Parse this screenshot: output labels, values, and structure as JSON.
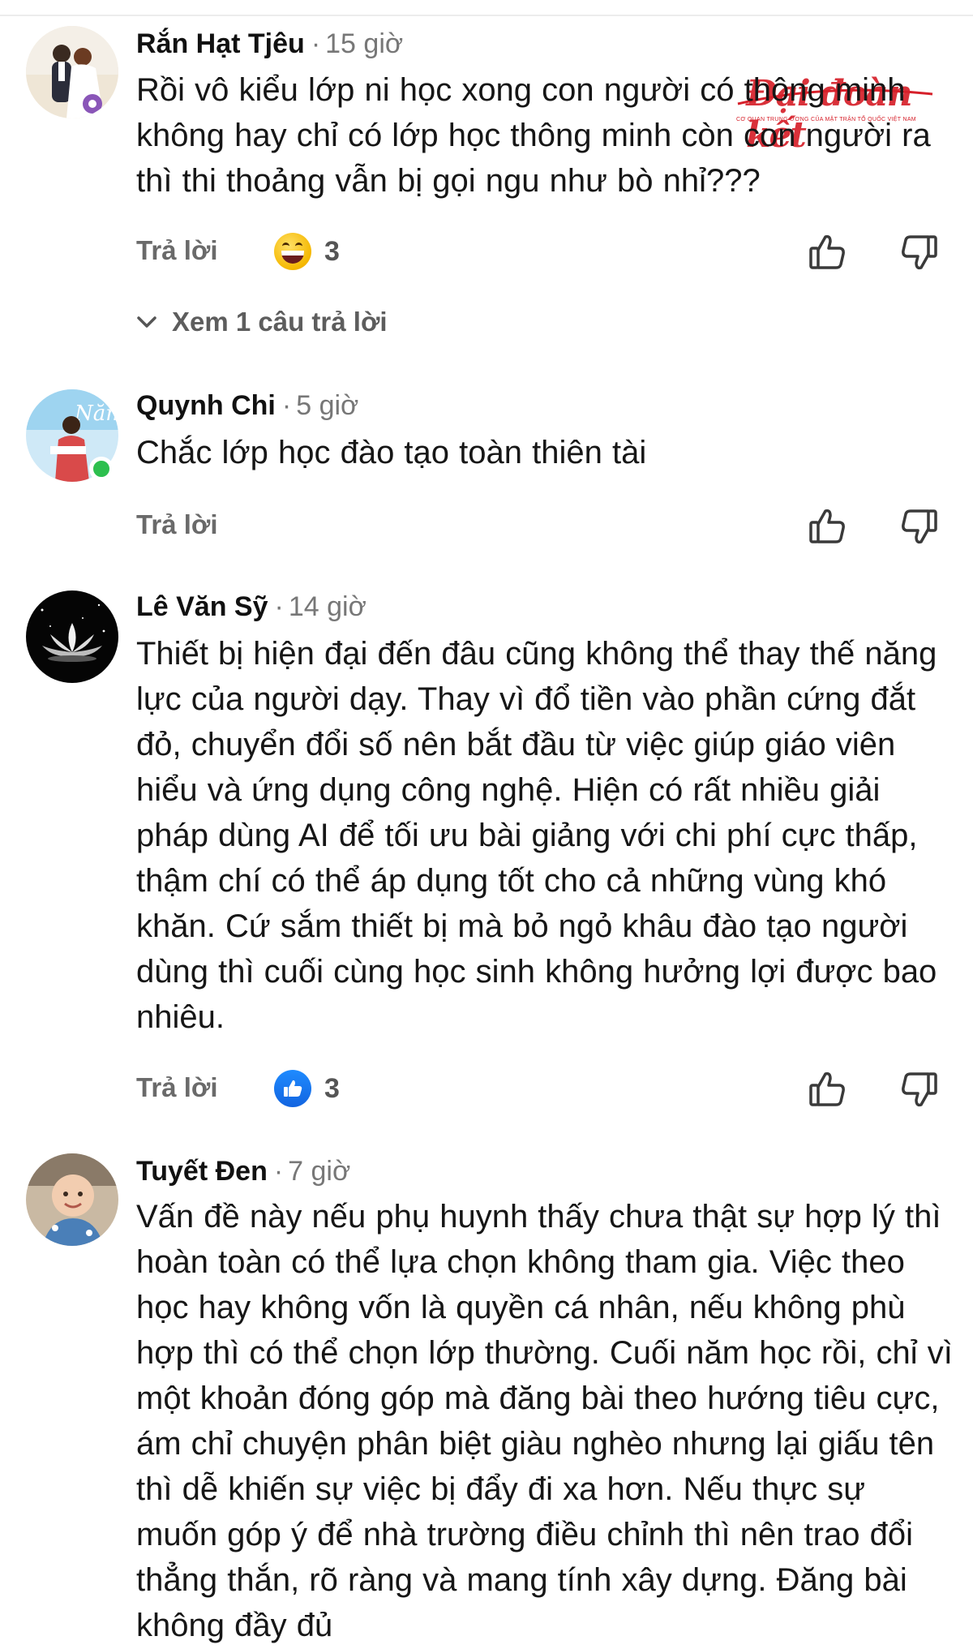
{
  "watermark": {
    "brand": "Đại đoàn kết",
    "subtitle": "CƠ QUAN TRUNG ƯƠNG CỦA MẶT TRẬN TỔ QUỐC VIỆT NAM"
  },
  "labels": {
    "reply": "Trả lời",
    "separator": "·"
  },
  "comments": [
    {
      "author": "Rắn Hạt Tjêu",
      "time": "15 giờ",
      "text": "Rồi vô kiểu lớp ni học xong con người có thông minh không hay chỉ có lớp học thông minh còn con người ra thì thi thoảng vẫn bị gọi ngu như bò nhỉ???",
      "reaction_icon": "laughing-emoji-icon",
      "reaction_count": "3",
      "view_replies": "Xem 1 câu trả lời"
    },
    {
      "author": "Quynh Chi",
      "time": "5 giờ",
      "text": "Chắc lớp học đào tạo toàn thiên tài",
      "online": true
    },
    {
      "author": "Lê Văn Sỹ",
      "time": "14 giờ",
      "text": "Thiết bị hiện đại đến đâu cũng không thể thay thế năng lực của người dạy. Thay vì đổ tiền vào phần cứng đắt đỏ, chuyển đổi số nên bắt đầu từ việc giúp giáo viên hiểu và ứng dụng công nghệ. Hiện có rất nhiều giải pháp dùng AI để tối ưu bài giảng với chi phí cực thấp, thậm chí có thể áp dụng tốt cho cả những vùng khó khăn. Cứ sắm thiết bị mà bỏ ngỏ khâu đào tạo người dùng thì cuối cùng học sinh không hưởng lợi được bao nhiêu.",
      "reaction_icon": "like-badge-icon",
      "reaction_count": "3"
    },
    {
      "author": "Tuyết Đen",
      "time": "7 giờ",
      "text": "Vấn đề này nếu phụ huynh thấy chưa thật sự hợp lý thì hoàn toàn có thể lựa chọn không tham gia. Việc theo học hay không vốn là quyền cá nhân, nếu không phù hợp thì có thể chọn lớp thường. Cuối năm học rồi, chỉ vì một khoản đóng góp mà đăng bài theo hướng tiêu cực, ám chỉ chuyện phân biệt giàu nghèo nhưng lại giấu tên thì dễ khiến sự việc bị đẩy đi xa hơn. Nếu thực sự muốn góp ý để nhà trường điều chỉnh thì nên trao đổi thẳng thắn, rõ ràng và mang tính xây dựng. Đăng bài không đầy đủ"
    }
  ],
  "colors": {
    "like_blue": "#1877f2",
    "online_green": "#2dbf4e",
    "watermark_red": "#d6202a"
  }
}
